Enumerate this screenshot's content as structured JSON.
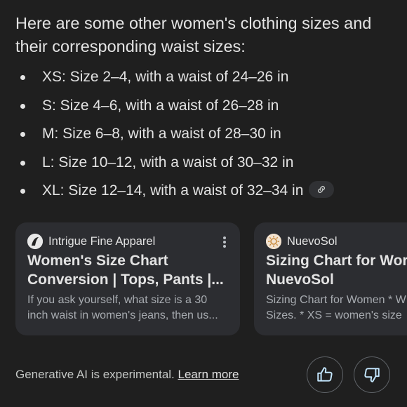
{
  "intro": "Here are some other women's clothing sizes and their corresponding waist sizes:",
  "sizes": [
    "XS: Size 2–4, with a waist of 24–26 in",
    "S: Size 4–6, with a waist of 26–28 in",
    "M: Size 6–8, with a waist of 28–30 in",
    "L: Size 10–12, with a waist of 30–32 in",
    "XL: Size 12–14, with a waist of 32–34 in"
  ],
  "cards": [
    {
      "source": "Intrigue Fine Apparel",
      "title_line1": "Women's Size Chart",
      "title_line2": "Conversion | Tops, Pants |...",
      "snippet_line1": "If you ask yourself, what size is a 30",
      "snippet_line2": "inch waist in women's jeans, then us..."
    },
    {
      "source": "NuevoSol",
      "title_line1": "Sizing Chart for Wor",
      "title_line2": "NuevoSol",
      "snippet_line1": "Sizing Chart for Women * W",
      "snippet_line2": "Sizes. * XS = women's size"
    }
  ],
  "footer": {
    "disclaimer": "Generative AI is experimental.",
    "learn_more": "Learn more"
  },
  "icons": {
    "link": "link-icon",
    "more": "more-vert-icon",
    "thumbs_up": "thumbs-up-icon",
    "thumbs_down": "thumbs-down-icon"
  },
  "colors": {
    "background": "#1f1f1f",
    "card": "#2c2d31",
    "text": "#e3e3e3",
    "muted": "#a8acb1"
  }
}
